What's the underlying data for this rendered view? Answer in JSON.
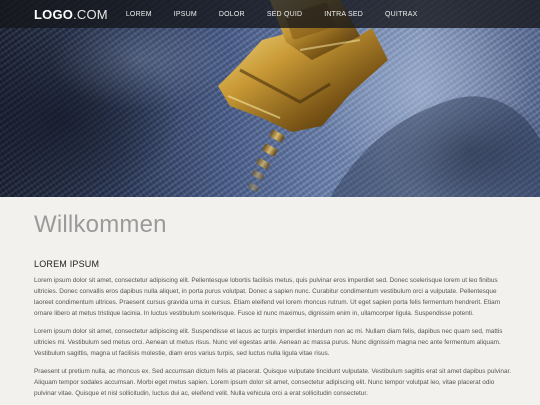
{
  "nav": {
    "logo_bold": "LOGO",
    "logo_rest": ".COM",
    "items": [
      {
        "label": "LOREM"
      },
      {
        "label": "IPSUM"
      },
      {
        "label": "DOLOR"
      },
      {
        "label": "SED QUID"
      },
      {
        "label": "INTRA SED"
      },
      {
        "label": "QUITRAX"
      }
    ]
  },
  "hero": {
    "image": "zipper-on-denim"
  },
  "content": {
    "heading": "Willkommen",
    "section_title": "LOREM IPSUM",
    "paragraphs": [
      "Lorem ipsum dolor sit amet, consectetur adipiscing elit. Pellentesque lobortis facilisis metus, quis pulvinar eros imperdiet sed. Donec scelerisque lorem ut leo finibus ultricies. Donec convallis eros dapibus nulla aliquet, in porta purus volutpat. Donec a sapien nunc. Curabitur condimentum vestibulum orci a vulputate. Pellentesque laoreet condimentum ultrices. Praesent cursus gravida urna in cursus. Etiam eleifend vel lorem rhoncus rutrum. Ut eget sapien porta felis fermentum hendrerit. Etiam ornare libero at metus tristique lacinia. In luctus vestibulum scelerisque. Fusce id nunc maximus, dignissim enim in, ullamcorper ligula. Suspendisse potenti.",
      "Lorem ipsum dolor sit amet, consectetur adipiscing elit. Suspendisse et lacus ac turpis imperdiet interdum non ac mi. Nullam diam felis, dapibus nec quam sed, mattis ultricies mi. Vestibulum sed metus orci. Aenean ut metus risus. Nunc vel egestas ante. Aenean ac massa purus. Nunc dignissim magna nec ante fermentum aliquam. Vestibulum sagittis, magna ut facilisis molestie, diam eros varius turpis, sed luctus nulla ligula vitae risus.",
      "Praesent ut pretium nulla, ac rhoncus ex. Sed accumsan dictum felis at placerat. Quisque vulputate tincidunt vulputate. Vestibulum sagittis erat sit amet dapibus pulvinar. Aliquam tempor sodales accumsan. Morbi eget metus sapien. Lorem ipsum dolor sit amet, consectetur adipiscing elit. Nunc tempor volutpat leo, vitae placerat odio pulvinar vitae. Quisque et nisl sollicitudin, luctus dui ac, eleifend velit. Nulla vehicula orci a erat sollicitudin consectetur."
    ]
  }
}
